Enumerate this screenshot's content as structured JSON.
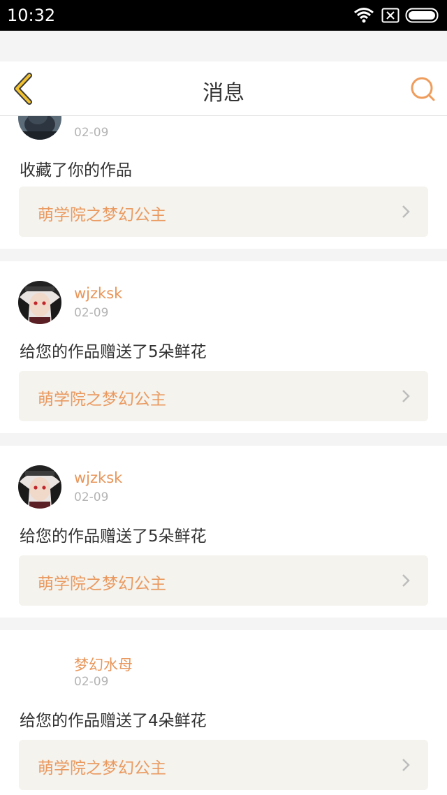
{
  "status_bar": {
    "time": "10:32"
  },
  "header": {
    "title": "消息"
  },
  "messages": [
    {
      "username": "",
      "date": "02-09",
      "action": "收藏了你的作品",
      "work_title": "萌学院之梦幻公主"
    },
    {
      "username": "wjzksk",
      "date": "02-09",
      "action": "给您的作品赠送了5朵鲜花",
      "work_title": "萌学院之梦幻公主"
    },
    {
      "username": "wjzksk",
      "date": "02-09",
      "action": "给您的作品赠送了5朵鲜花",
      "work_title": "萌学院之梦幻公主"
    },
    {
      "username": "梦幻水母",
      "date": "02-09",
      "action": "给您的作品赠送了4朵鲜花",
      "work_title": "萌学院之梦幻公主"
    }
  ],
  "colors": {
    "accent": "#e8965a",
    "back_icon": "#f2c230",
    "link_bg": "#f4f3ee"
  }
}
